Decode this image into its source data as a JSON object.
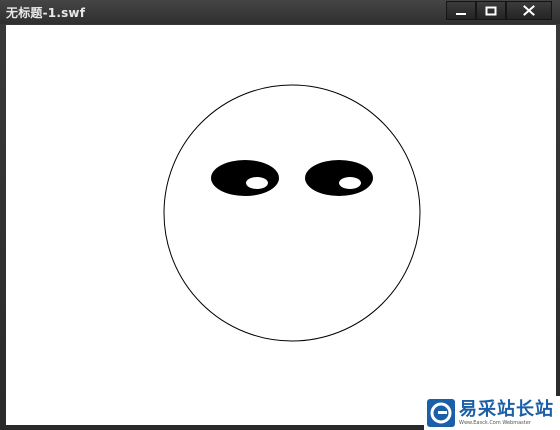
{
  "window": {
    "title": "无标题-1.swf"
  },
  "controls": {
    "minimize_icon": "minimize-icon",
    "maximize_icon": "maximize-icon",
    "close_icon": "close-icon"
  },
  "stage": {
    "background": "#ffffff",
    "face_stroke": "#000000",
    "eye_fill": "#000000",
    "pupil_fill": "#ffffff"
  },
  "watermark": {
    "brand": "易采站长站",
    "tagline": "Www.Easck.Com  Webmaster",
    "logo_icon": "easck-logo-icon",
    "brand_color": "#1a5fa8"
  }
}
